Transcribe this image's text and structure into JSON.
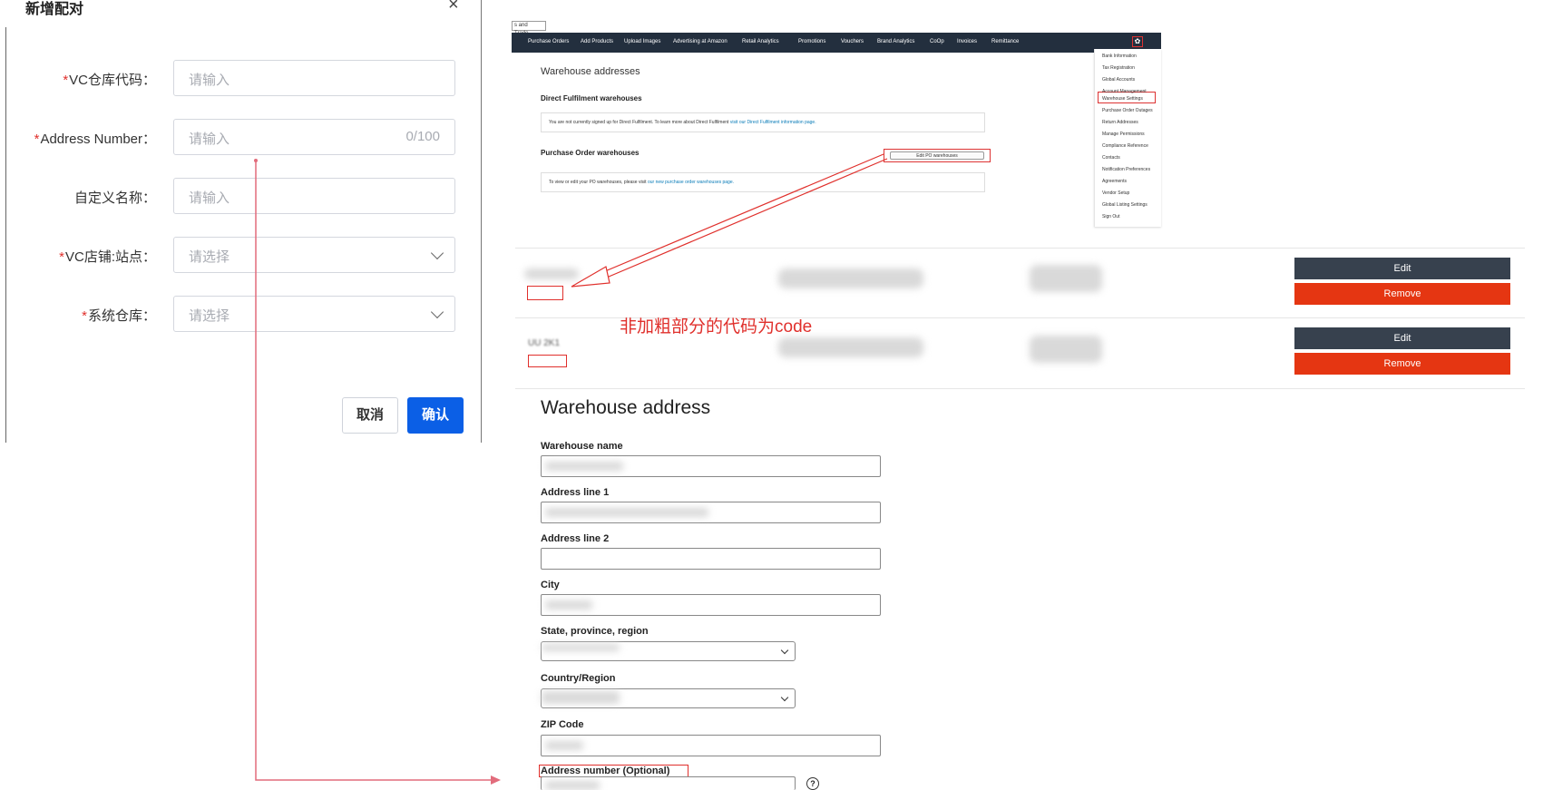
{
  "dialog": {
    "title": "新增配对",
    "close_glyph": "×",
    "fields": [
      {
        "label": "VC仓库代码：",
        "required": true,
        "placeholder": "请输入",
        "type": "input"
      },
      {
        "label": "Address Number：",
        "required": true,
        "placeholder": "请输入",
        "counter": "0/100",
        "type": "input"
      },
      {
        "label": "自定义名称：",
        "required": false,
        "placeholder": "请输入",
        "type": "input"
      },
      {
        "label": "VC店铺:站点：",
        "required": true,
        "placeholder": "请选择",
        "type": "select"
      },
      {
        "label": "系统仓库：",
        "required": true,
        "placeholder": "请选择",
        "type": "select"
      }
    ],
    "required_mark": "*",
    "cancel_label": "取消",
    "confirm_label": "确认"
  },
  "amazon": {
    "tab_label": "s and Trade...",
    "nav": [
      "Purchase Orders",
      "Add Products",
      "Upload Images",
      "Advertising at Amazon",
      "Retail Analytics",
      "Promotions",
      "Vouchers",
      "Brand Analytics",
      "CoOp",
      "Invoices",
      "Remittance"
    ],
    "gear_icon": "gear-icon",
    "page_title": "Warehouse addresses",
    "df_heading": "Direct Fulfilment warehouses",
    "df_text": "You are not currently signed up for Direct Fulfilment. To learn more about Direct Fulfilment",
    "df_link": "visit our Direct Fulfilment information page.",
    "po_heading": "Purchase Order warehouses",
    "edit_po_label": "Edit PO warehouses",
    "po_text": "To view or edit your PO warehouses, please visit",
    "po_link": "our new purchase order warehouses page.",
    "menu": [
      "Bank Information",
      "Tax Registration",
      "Global Accounts",
      "Account Management",
      "Warehouse Settings",
      "Purchase Order Outages",
      "Return Addresses",
      "Manage Permissions",
      "Compliance Reference",
      "Contacts",
      "Notification Preferences",
      "Agreements",
      "Vendor Setup",
      "Global Listing Settings",
      "Sign Out"
    ]
  },
  "rows": {
    "edit_label": "Edit",
    "remove_label": "Remove",
    "row2_partial_code": "UU 2K1"
  },
  "annotation": "非加粗部分的代码为code",
  "address_form": {
    "title": "Warehouse address",
    "labels": {
      "name": "Warehouse name",
      "line1": "Address line 1",
      "line2": "Address line 2",
      "city": "City",
      "state": "State, province, region",
      "country": "Country/Region",
      "zip": "ZIP Code",
      "addrnum": "Address number (Optional)"
    },
    "help_glyph": "?"
  },
  "colors": {
    "required": "#e0302c",
    "primary_button": "#0b5fe6",
    "amazon_bar": "#232f3e",
    "edit_button": "#37414e",
    "remove_button": "#e53612",
    "annotation": "#e0302c",
    "arrow_pink": "#e26c7c"
  }
}
